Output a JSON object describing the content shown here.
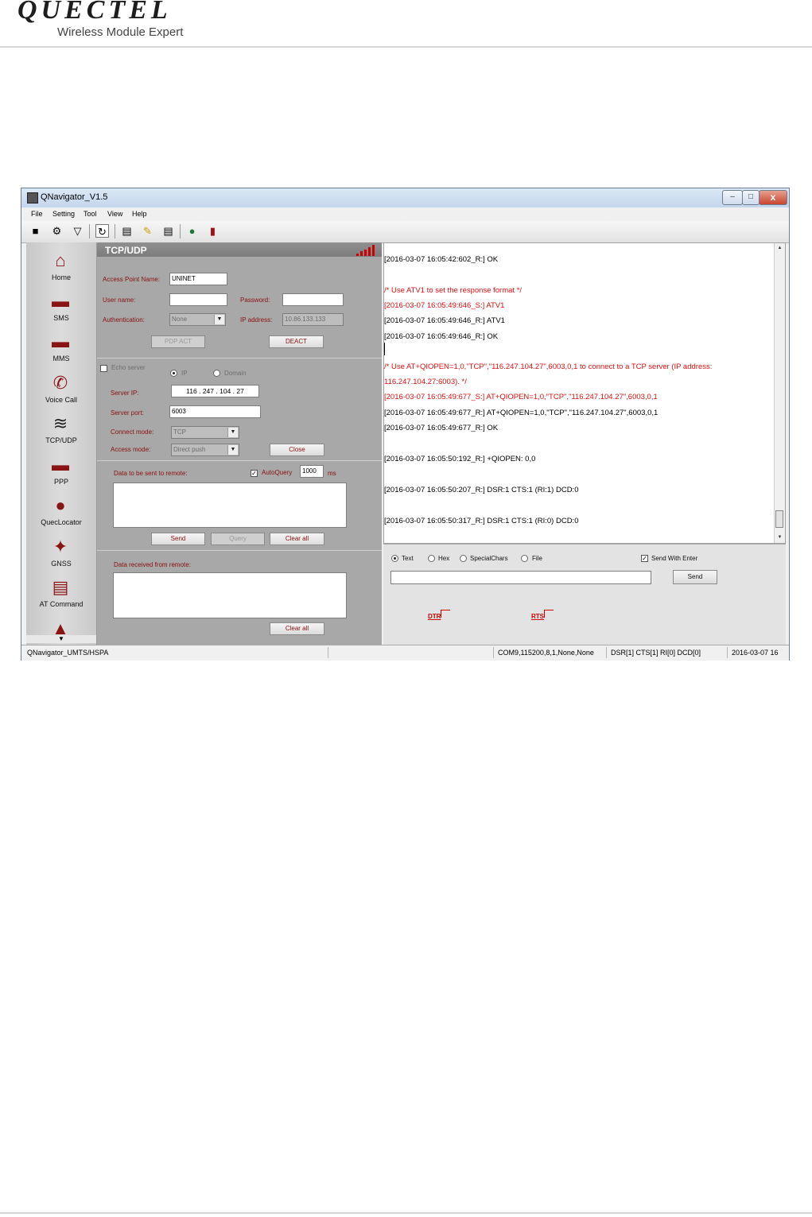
{
  "page": {
    "logo": "QUECTEL",
    "tagline": "Wireless Module Expert"
  },
  "window": {
    "title": "QNavigator_V1.5",
    "minimize": "–",
    "maximize": "□",
    "close": "x"
  },
  "menu": [
    "File",
    "Setting",
    "Tool",
    "View",
    "Help"
  ],
  "toolbar_icons": [
    "save-icon",
    "settings-icon",
    "filter-icon",
    "refresh-icon",
    "floppy-icon",
    "broom-icon",
    "document-icon",
    "globe-icon",
    "book-icon"
  ],
  "sidebar": {
    "items": [
      {
        "label": "Home",
        "icon": "home-icon"
      },
      {
        "label": "SMS",
        "icon": "sms-icon"
      },
      {
        "label": "MMS",
        "icon": "mms-icon"
      },
      {
        "label": "Voice Call",
        "icon": "phone-icon"
      },
      {
        "label": "TCP/UDP",
        "icon": "wifi-icon"
      },
      {
        "label": "PPP",
        "icon": "ppp-icon"
      },
      {
        "label": "QuecLocator",
        "icon": "globe-icon"
      },
      {
        "label": "GNSS",
        "icon": "satellite-icon"
      },
      {
        "label": "AT Command",
        "icon": "at-command-icon"
      }
    ],
    "more_icon": "more-icon"
  },
  "panel": {
    "title": "TCP/UDP",
    "apn_label": "Access Point Name:",
    "apn_value": "UNINET",
    "username_label": "User name:",
    "username_value": "",
    "password_label": "Password:",
    "password_value": "",
    "auth_label": "Authentication:",
    "auth_value": "None",
    "ip_label": "IP address:",
    "ip_value": "10.86.133.133",
    "pdp_act": "PDP ACT",
    "deact": "DEACT",
    "echo_label": "Echo server",
    "mode_ip": "IP",
    "mode_domain": "Domain",
    "server_ip_label": "Server IP:",
    "server_ip": [
      "116",
      "247",
      "104",
      "27"
    ],
    "server_port_label": "Server port:",
    "server_port_value": "6003",
    "connect_mode_label": "Connect mode:",
    "connect_mode_value": "TCP",
    "access_mode_label": "Access mode:",
    "access_mode_value": "Direct push",
    "close": "Close",
    "send_label": "Data to be sent to remote:",
    "autoquery_label": "AutoQuery",
    "autoquery_value": "1000",
    "autoquery_unit": "ms",
    "send": "Send",
    "query": "Query",
    "clear_all": "Clear all",
    "received_label": "Data received from remote:",
    "clear_all_2": "Clear all"
  },
  "log": [
    {
      "text": "[2016-03-07 16:05:42:602_R:] OK",
      "color": "black"
    },
    {
      "text": "/* Use ATV1 to set the response format */",
      "color": "red"
    },
    {
      "text": "[2016-03-07 16:05:49:646_S:] ATV1",
      "color": "red"
    },
    {
      "text": "[2016-03-07 16:05:49:646_R:] ATV1",
      "color": "black"
    },
    {
      "text": "[2016-03-07 16:05:49:646_R:] OK",
      "color": "black"
    },
    {
      "text": "/* Use AT+QIOPEN=1,0,\"TCP\",\"116.247.104.27\",6003,0,1 to connect to a TCP server (IP address:",
      "color": "red"
    },
    {
      "text": "116.247.104.27:6003). */",
      "color": "red"
    },
    {
      "text": "[2016-03-07 16:05:49:677_S:] AT+QIOPEN=1,0,\"TCP\",\"116.247.104.27\",6003,0,1",
      "color": "red"
    },
    {
      "text": "[2016-03-07 16:05:49:677_R:] AT+QIOPEN=1,0,\"TCP\",\"116.247.104.27\",6003,0,1",
      "color": "black"
    },
    {
      "text": "[2016-03-07 16:05:49:677_R:] OK",
      "color": "black"
    },
    {
      "text": "[2016-03-07 16:05:50:192_R:] +QIOPEN: 0,0",
      "color": "black"
    },
    {
      "text": "[2016-03-07 16:05:50:207_R:] DSR:1 CTS:1 (RI:1) DCD:0",
      "color": "black"
    },
    {
      "text": "[2016-03-07 16:05:50:317_R:] DSR:1 CTS:1 (RI:0) DCD:0",
      "color": "black"
    }
  ],
  "sendpane": {
    "text": "Text",
    "hex": "Hex",
    "specialchars": "SpecialChars",
    "file": "File",
    "send_with_enter": "Send With Enter",
    "input_value": "",
    "send": "Send",
    "dtr": "DTR",
    "rts": "RTS"
  },
  "status": {
    "product": "QNavigator_UMTS/HSPA",
    "blank": "",
    "port": "COM9,115200,8,1,None,None",
    "lines": "DSR[1] CTS[1] RI[0] DCD[0]",
    "time": "2016-03-07 16"
  },
  "colors": {
    "label_red": "#8a1010",
    "log_red": "#e01010",
    "panel_gray": "#a8a8a8"
  }
}
